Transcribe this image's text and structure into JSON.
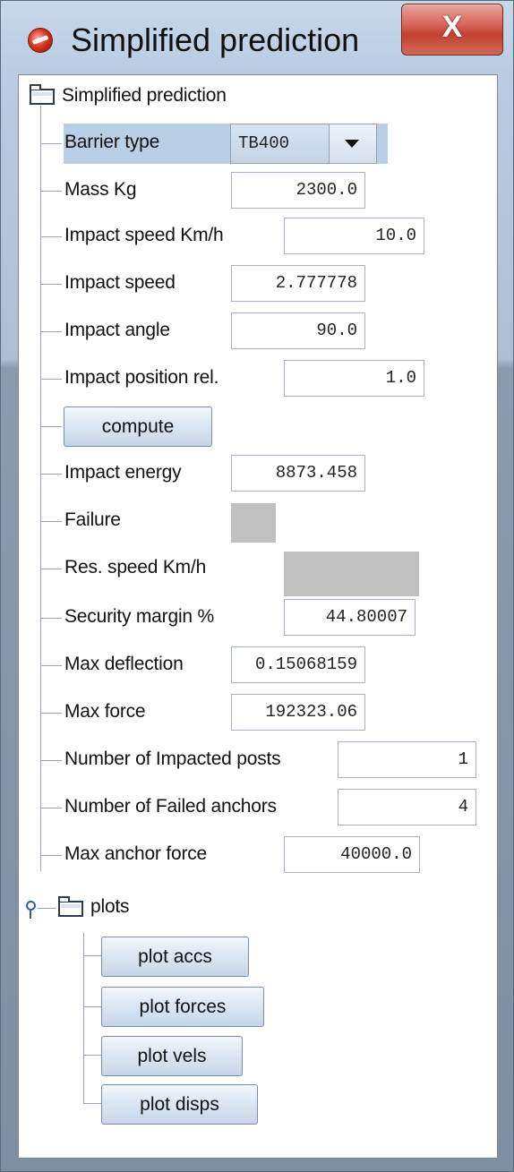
{
  "window": {
    "title": "Simplified prediction",
    "close_label": "X"
  },
  "tree": {
    "root_label": "Simplified prediction",
    "barrier_type": {
      "label": "Barrier type",
      "value": "TB400"
    },
    "rows": [
      {
        "label": "Mass Kg",
        "value": "2300.0"
      },
      {
        "label": "Impact speed Km/h",
        "value": "10.0"
      },
      {
        "label": "Impact speed",
        "value": "2.777778"
      },
      {
        "label": "Impact angle",
        "value": "90.0"
      },
      {
        "label": "Impact position rel.",
        "value": "1.0"
      }
    ],
    "compute_label": "compute",
    "results": [
      {
        "label": "Impact energy",
        "value": "8873.458"
      },
      {
        "label": "Failure",
        "value": ""
      },
      {
        "label": "Res. speed Km/h",
        "value": ""
      },
      {
        "label": "Security margin %",
        "value": "44.80007"
      },
      {
        "label": "Max deflection",
        "value": "0.15068159"
      },
      {
        "label": "Max force",
        "value": "192323.06"
      },
      {
        "label": "Number of Impacted posts",
        "value": "1"
      },
      {
        "label": "Number of Failed anchors",
        "value": "4"
      },
      {
        "label": "Max anchor force",
        "value": "40000.0"
      }
    ],
    "plots": {
      "label": "plots",
      "buttons": [
        "plot accs",
        "plot forces",
        "plot vels",
        "plot disps"
      ]
    }
  },
  "colors": {
    "selection": "#b8cfe5",
    "empty_output": "#c0c0c0",
    "close_button": "#c3412f"
  },
  "icons": {
    "app": "app-logo-icon",
    "folder": "folder-icon",
    "handle": "tree-handle-icon"
  }
}
